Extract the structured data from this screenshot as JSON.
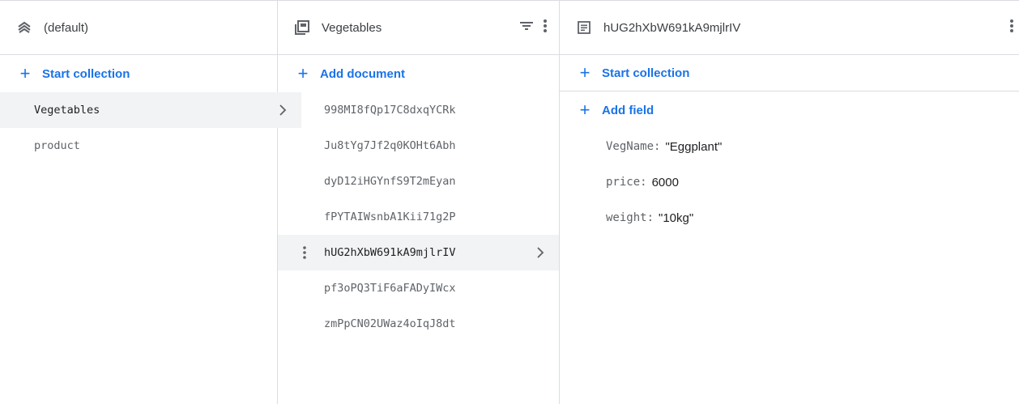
{
  "panels": {
    "root": {
      "title": "(default)",
      "action_label": "Start collection",
      "items": [
        {
          "label": "Vegetables",
          "selected": true
        },
        {
          "label": "product",
          "selected": false
        }
      ]
    },
    "collection": {
      "title": "Vegetables",
      "action_label": "Add document",
      "items": [
        {
          "label": "998MI8fQp17C8dxqYCRk"
        },
        {
          "label": "Ju8tYg7Jf2q0KOHt6Abh"
        },
        {
          "label": "dyD12iHGYnfS9T2mEyan"
        },
        {
          "label": "fPYTAIWsnbA1Kii71g2P"
        },
        {
          "label": "hUG2hXbW691kA9mjlrIV",
          "selected": true
        },
        {
          "label": "pf3oPQ3TiF6aFADyIWcx"
        },
        {
          "label": "zmPpCN02UWaz4oIqJ8dt"
        }
      ]
    },
    "document": {
      "title": "hUG2hXbW691kA9mjlrIV",
      "start_collection_label": "Start collection",
      "add_field_label": "Add field",
      "fields": [
        {
          "key": "VegName",
          "sep": ":",
          "value": "\"Eggplant\""
        },
        {
          "key": "price",
          "sep": ":",
          "value": "6000"
        },
        {
          "key": "weight",
          "sep": ":",
          "value": "\"10kg\""
        }
      ]
    }
  },
  "icons": {
    "root": "database-layers-icon",
    "collection": "collection-icon",
    "document": "document-icon",
    "filter": "filter-icon",
    "more": "more-vert-icon",
    "chevron": "chevron-right-icon",
    "plus": "plus-icon"
  },
  "colors": {
    "accent": "#1a73e8",
    "selected_bg": "#f1f3f4",
    "border": "#dadce0"
  }
}
